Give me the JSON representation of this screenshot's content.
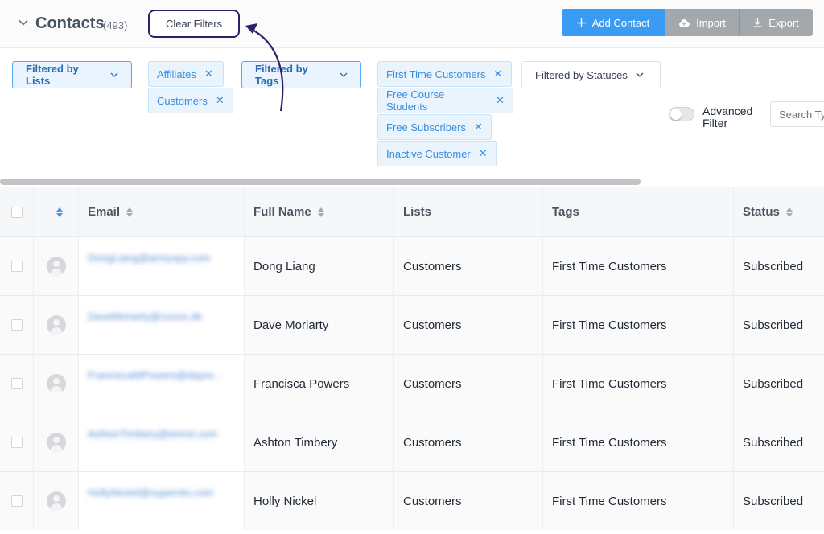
{
  "header": {
    "title": "Contacts",
    "count": "(493)",
    "clear_filters": "Clear Filters",
    "add_contact": "Add Contact",
    "import": "Import",
    "export": "Export"
  },
  "filters": {
    "lists_label": "Filtered by Lists",
    "lists": [
      "Affiliates",
      "Customers"
    ],
    "tags_label": "Filtered by Tags",
    "tags": [
      "First Time Customers",
      "Free Course Students",
      "Free Subscribers",
      "Inactive Customer"
    ],
    "statuses_label": "Filtered by Statuses",
    "advanced_filter": "Advanced Filter",
    "search_placeholder": "Search Ty"
  },
  "table": {
    "columns": {
      "email": "Email",
      "full_name": "Full Name",
      "lists": "Lists",
      "tags": "Tags",
      "status": "Status"
    },
    "rows": [
      {
        "email": "DongLiang@armyspy.com",
        "full_name": "Dong Liang",
        "lists": "Customers",
        "tags": "First Time Customers",
        "status": "Subscribed"
      },
      {
        "email": "DaveMoriarty@cuvox.de",
        "full_name": "Dave Moriarty",
        "lists": "Customers",
        "tags": "First Time Customers",
        "status": "Subscribed"
      },
      {
        "email": "FranciscaMPowers@dayre...",
        "full_name": "Francisca Powers",
        "lists": "Customers",
        "tags": "First Time Customers",
        "status": "Subscribed"
      },
      {
        "email": "AshtonTimbery@einrot.com",
        "full_name": "Ashton Timbery",
        "lists": "Customers",
        "tags": "First Time Customers",
        "status": "Subscribed"
      },
      {
        "email": "HollyNickel@superrito.com",
        "full_name": "Holly Nickel",
        "lists": "Customers",
        "tags": "First Time Customers",
        "status": "Subscribed"
      }
    ]
  },
  "colors": {
    "accent": "#3a9bf5",
    "annotation": "#2d2069"
  }
}
